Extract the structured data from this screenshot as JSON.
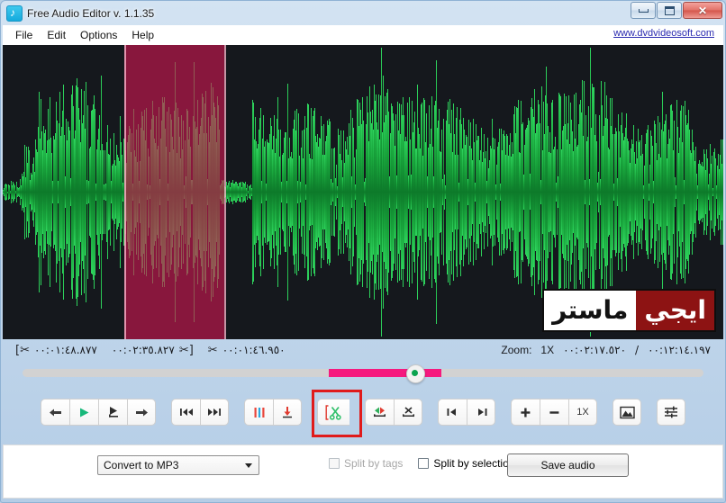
{
  "window": {
    "title": "Free Audio Editor v. 1.1.35",
    "app_icon": "music-note-icon",
    "minimize_label": "Minimize",
    "maximize_label": "Maximize",
    "close_label": "✕"
  },
  "menu": {
    "items": [
      {
        "label": "File"
      },
      {
        "label": "Edit"
      },
      {
        "label": "Options"
      },
      {
        "label": "Help"
      }
    ],
    "site_link": "www.dvdvideosoft.com"
  },
  "waveform": {
    "background_color": "#15181d",
    "wave_color": "#17a03a",
    "selection_color": "#ce1650",
    "selection_start_pct": 16.9,
    "selection_end_pct": 30.8,
    "watermark": {
      "white_part": "ماستر",
      "red_part": "ايجي",
      "red_color": "#8d1313"
    }
  },
  "times": {
    "selection_start_icon": "cut-start-icon",
    "selection_start": "٠٠:٠١:٤٨.٨٧٧",
    "selection_end": "٠٠:٠٢:٣٥.٨٢٧",
    "selection_end_icon": "cut-end-icon",
    "selection_length_icon": "cut-length-icon",
    "selection_length": "٠٠:٠١:٤٦.٩٥٠",
    "zoom_label": "Zoom:",
    "zoom_value": "1X",
    "position": "٠٠:٠٢:١٧.٥٢٠",
    "separator": "/",
    "duration": "٠٠:١٢:١٤.١٩٧"
  },
  "scrubber": {
    "fill_start_pct": 45.0,
    "fill_end_pct": 61.5,
    "knob_pct": 57.5,
    "fill_color": "#f5197e",
    "track_color": "#d2d2d2"
  },
  "toolbar": {
    "groups": [
      {
        "buttons": [
          {
            "name": "rewind-button",
            "icon": "arrow-left-icon"
          },
          {
            "name": "play-button",
            "icon": "play-icon"
          },
          {
            "name": "play-from-cursor-button",
            "icon": "play-from-marker-icon"
          },
          {
            "name": "forward-button",
            "icon": "arrow-right-icon"
          }
        ]
      },
      {
        "buttons": [
          {
            "name": "skip-to-start-button",
            "icon": "skip-back-icon"
          },
          {
            "name": "skip-to-end-button",
            "icon": "skip-forward-icon"
          }
        ]
      },
      {
        "buttons": [
          {
            "name": "add-marker-button",
            "icon": "markers-icon"
          },
          {
            "name": "insert-marker-button",
            "icon": "marker-down-icon"
          }
        ]
      },
      {
        "buttons": [
          {
            "name": "cut-selection-button",
            "icon": "scissors-bracket-icon",
            "highlighted": true
          }
        ]
      },
      {
        "buttons": [
          {
            "name": "trim-selection-button",
            "icon": "trim-icon"
          },
          {
            "name": "delete-selection-button",
            "icon": "delete-region-icon"
          }
        ]
      },
      {
        "buttons": [
          {
            "name": "go-selection-start-button",
            "icon": "jump-start-icon"
          },
          {
            "name": "go-selection-end-button",
            "icon": "jump-end-icon"
          }
        ]
      },
      {
        "buttons": [
          {
            "name": "zoom-in-button",
            "icon": "plus-icon",
            "label": "+"
          },
          {
            "name": "zoom-out-button",
            "icon": "minus-icon",
            "label": "−"
          },
          {
            "name": "zoom-reset-button",
            "icon": "zoom-level-icon",
            "label": "1X"
          }
        ]
      },
      {
        "buttons": [
          {
            "name": "view-image-button",
            "icon": "picture-icon"
          }
        ]
      },
      {
        "buttons": [
          {
            "name": "settings-button",
            "icon": "sliders-icon"
          }
        ]
      }
    ],
    "highlight_color": "#e01b1b"
  },
  "bottom": {
    "format_select": {
      "value": "Convert to MP3",
      "chevron": "chevron-down-icon"
    },
    "split_by_tags": {
      "label": "Split by tags",
      "checked": false,
      "enabled": false
    },
    "split_by_selections": {
      "label": "Split by selections",
      "checked": false,
      "enabled": true
    },
    "save_button": "Save audio"
  }
}
